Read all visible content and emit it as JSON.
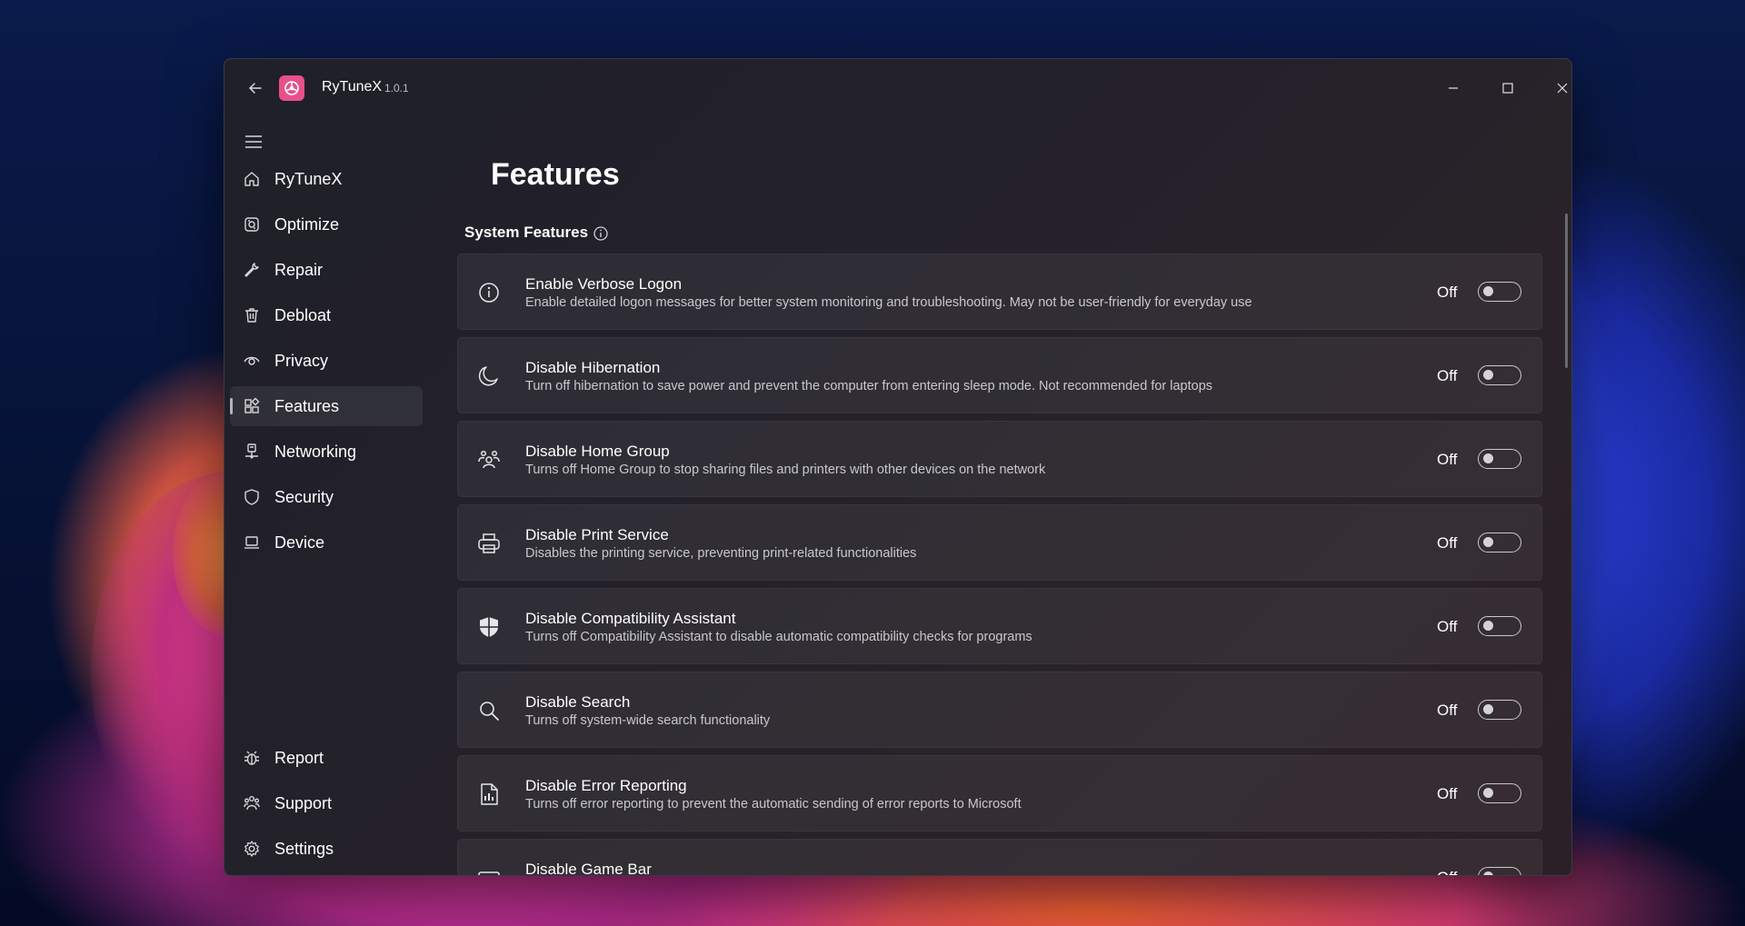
{
  "colors": {
    "app_logo": "#e8508a",
    "window_bg": "#23212a",
    "card_bg": "#2c2a33",
    "toggle_border": "#c9c9cf"
  },
  "titlebar": {
    "back_icon": "back-arrow-icon",
    "logo_icon": "rytunex-logo-icon",
    "app_name": "RyTuneX",
    "version": "1.0.1",
    "minimize_icon": "minimize-icon",
    "maximize_icon": "maximize-icon",
    "close_icon": "close-icon"
  },
  "sidebar": {
    "menu_icon": "hamburger-menu-icon",
    "items": [
      {
        "label": "RyTuneX",
        "icon": "home-icon"
      },
      {
        "label": "Optimize",
        "icon": "optimize-icon"
      },
      {
        "label": "Repair",
        "icon": "wrench-icon"
      },
      {
        "label": "Debloat",
        "icon": "trash-icon"
      },
      {
        "label": "Privacy",
        "icon": "eye-icon"
      },
      {
        "label": "Features",
        "icon": "apps-icon",
        "selected": true
      },
      {
        "label": "Networking",
        "icon": "network-icon"
      },
      {
        "label": "Security",
        "icon": "shield-icon"
      },
      {
        "label": "Device",
        "icon": "laptop-icon"
      }
    ],
    "footer_items": [
      {
        "label": "Report",
        "icon": "bug-icon"
      },
      {
        "label": "Support",
        "icon": "support-icon"
      },
      {
        "label": "Settings",
        "icon": "gear-icon"
      }
    ]
  },
  "main": {
    "title": "Features",
    "section_title": "System Features",
    "section_info_icon": "info-icon",
    "features": [
      {
        "title": "Enable Verbose Logon",
        "description": "Enable detailed logon messages for better system monitoring and troubleshooting. May not be user-friendly for everyday use",
        "state": "Off",
        "icon": "info-circle-icon"
      },
      {
        "title": "Disable Hibernation",
        "description": "Turn off hibernation to save power and prevent the computer from entering sleep mode. Not recommended for laptops",
        "state": "Off",
        "icon": "moon-icon"
      },
      {
        "title": "Disable Home Group",
        "description": "Turns off Home Group to stop sharing files and printers with other devices on the network",
        "state": "Off",
        "icon": "people-group-icon"
      },
      {
        "title": "Disable Print Service",
        "description": "Disables the printing service, preventing print-related functionalities",
        "state": "Off",
        "icon": "printer-icon"
      },
      {
        "title": "Disable Compatibility Assistant",
        "description": "Turns off Compatibility Assistant to disable automatic compatibility checks for programs",
        "state": "Off",
        "icon": "shield-quarters-icon"
      },
      {
        "title": "Disable Search",
        "description": "Turns off system-wide search functionality",
        "state": "Off",
        "icon": "search-icon"
      },
      {
        "title": "Disable Error Reporting",
        "description": "Turns off error reporting to prevent the automatic sending of error reports to Microsoft",
        "state": "Off",
        "icon": "report-document-icon"
      },
      {
        "title": "Disable Game Bar",
        "description": "",
        "state": "Off",
        "icon": "game-bar-icon"
      }
    ]
  }
}
